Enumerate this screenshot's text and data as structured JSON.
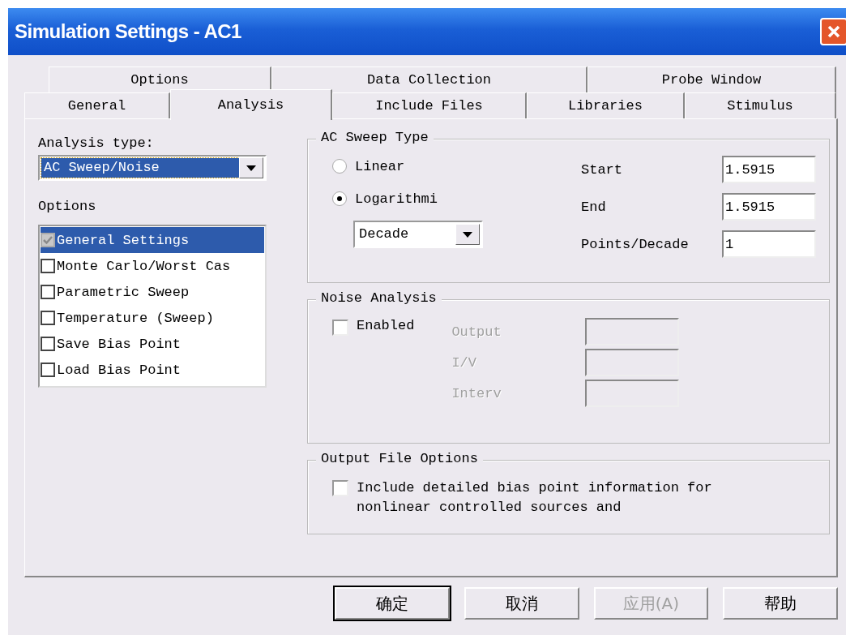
{
  "window": {
    "title": "Simulation Settings - AC1"
  },
  "tab_rows": [
    [
      {
        "label": "Options",
        "selected": false
      },
      {
        "label": "Data Collection",
        "selected": false
      },
      {
        "label": "Probe Window",
        "selected": false
      }
    ],
    [
      {
        "label": "General",
        "selected": false
      },
      {
        "label": "Analysis",
        "selected": true
      },
      {
        "label": "Include Files",
        "selected": false
      },
      {
        "label": "Libraries",
        "selected": false
      },
      {
        "label": "Stimulus",
        "selected": false
      }
    ]
  ],
  "analysis_type": {
    "label": "Analysis type:",
    "value": "AC Sweep/Noise"
  },
  "options": {
    "label": "Options",
    "items": [
      {
        "label": "General Settings",
        "checked": true,
        "disabled": true,
        "selected": true
      },
      {
        "label": "Monte Carlo/Worst Cas",
        "checked": false,
        "disabled": false,
        "selected": false
      },
      {
        "label": "Parametric Sweep",
        "checked": false,
        "disabled": false,
        "selected": false
      },
      {
        "label": "Temperature (Sweep)",
        "checked": false,
        "disabled": false,
        "selected": false
      },
      {
        "label": "Save Bias Point",
        "checked": false,
        "disabled": false,
        "selected": false
      },
      {
        "label": "Load Bias Point",
        "checked": false,
        "disabled": false,
        "selected": false
      }
    ]
  },
  "ac_sweep_type": {
    "title": "AC Sweep Type",
    "modes": [
      {
        "label": "Linear",
        "selected": false
      },
      {
        "label": "Logarithmi",
        "selected": true
      }
    ],
    "scale": "Decade",
    "fields": [
      {
        "label": "Start",
        "value": "1.5915"
      },
      {
        "label": "End",
        "value": "1.5915"
      },
      {
        "label": "Points/Decade",
        "value": "1"
      }
    ]
  },
  "noise_analysis": {
    "title": "Noise Analysis",
    "enabled": {
      "label": "Enabled",
      "checked": false
    },
    "fields": [
      {
        "label": "Output",
        "disabled": true
      },
      {
        "label": "I/V",
        "disabled": true
      },
      {
        "label": "Interv",
        "disabled": true
      }
    ]
  },
  "output_file_options": {
    "title": "Output File Options",
    "option": {
      "label": "Include detailed bias point information for nonlinear controlled sources and",
      "checked": false
    }
  },
  "buttons": [
    {
      "label": "确定",
      "disabled": false,
      "default": true
    },
    {
      "label": "取消",
      "disabled": false,
      "default": false
    },
    {
      "label": "应用(A)",
      "disabled": true,
      "default": false
    },
    {
      "label": "帮助",
      "disabled": false,
      "default": false
    }
  ]
}
